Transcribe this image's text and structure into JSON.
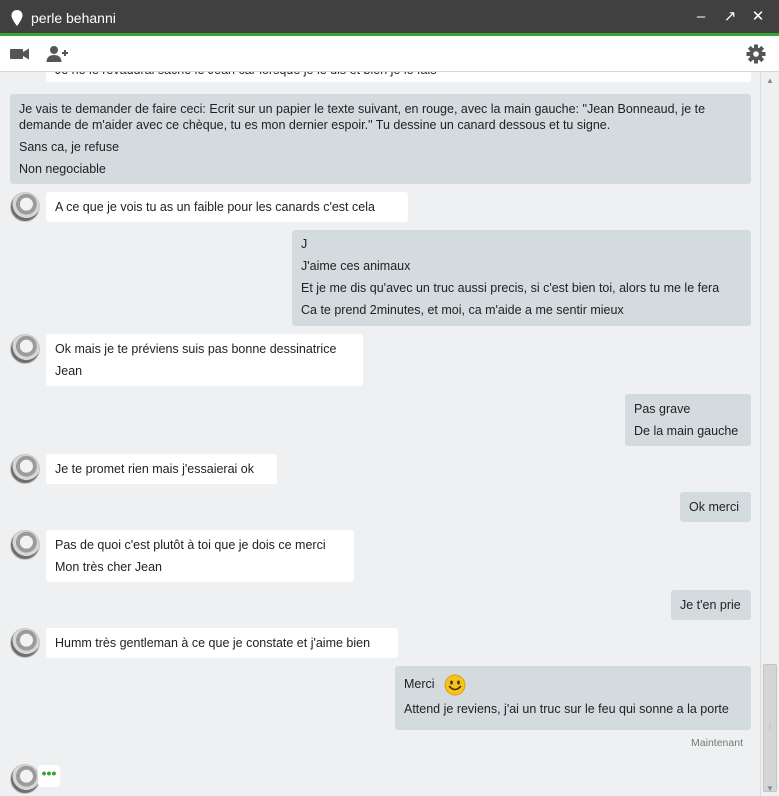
{
  "window": {
    "title": "perle behanni",
    "controls": {
      "minimize": "–",
      "popout": "↗",
      "close": "✕"
    }
  },
  "toolbar": {
    "video_icon": "video-camera-icon",
    "add_person_icon": "add-person-icon",
    "settings_icon": "gear-icon"
  },
  "messages": {
    "m0": {
      "lines": [
        "Je ne le revaudrai sache le Jean car lorsque je le dis et bien je le fais"
      ]
    },
    "m1": {
      "p1": "Je vais te demander de faire ceci: Ecrit sur un papier le texte suivant, en rouge, avec la main gauche: \"Jean Bonneaud, je te demande de m'aider avec ce chèque, tu es mon dernier espoir.\" Tu dessine un canard dessous et tu signe.",
      "p2": "Sans ca, je refuse",
      "p3": "Non negociable"
    },
    "m2": {
      "lines": [
        "A ce que je vois tu as un faible pour les canards  c'est cela"
      ]
    },
    "m3": {
      "lines": [
        "J",
        "J'aime ces animaux",
        "Et je me dis qu'avec un truc aussi precis, si c'est bien toi, alors tu me le fera",
        "Ca te prend 2minutes, et moi, ca m'aide a me sentir mieux"
      ]
    },
    "m4": {
      "lines": [
        "Ok mais je te préviens suis pas bonne dessinatrice",
        "Jean"
      ]
    },
    "m5": {
      "lines": [
        "Pas grave",
        "De la main gauche"
      ]
    },
    "m6": {
      "lines": [
        "Je te promet rien mais j'essaierai ok"
      ]
    },
    "m7": {
      "lines": [
        "Ok merci"
      ]
    },
    "m8": {
      "lines": [
        "Pas de quoi c'est plutôt à toi que je dois ce merci",
        "Mon très cher Jean"
      ]
    },
    "m9": {
      "lines": [
        "Je t'en prie"
      ]
    },
    "m10": {
      "lines": [
        "Humm très gentleman à ce que je constate et j'aime bien"
      ]
    },
    "m11": {
      "lines": [
        "Merci",
        "Attend je reviens, j'ai un truc sur le feu qui sonne a la porte"
      ],
      "emoji": "smiley-face-icon"
    }
  },
  "timestamp": "Maintenant",
  "typing_indicator": "•••",
  "colors": {
    "titlebar": "#404040",
    "accent": "#3aa335",
    "outgoing_bubble": "#d4dbde",
    "incoming_bubble": "#ffffff",
    "background": "#eef0f1"
  }
}
